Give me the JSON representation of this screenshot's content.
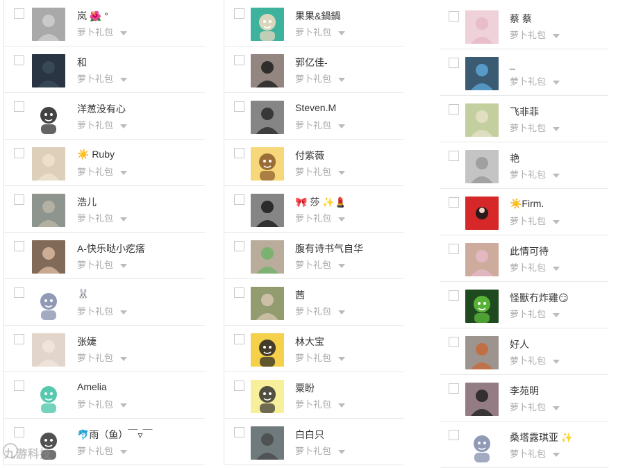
{
  "tag_label": "萝卜礼包",
  "watermark_text": "九游科技",
  "columns": [
    {
      "items": [
        {
          "name": "岚 🌺 °",
          "avatar": "avatar-photo",
          "colors": [
            "#8a8a8a",
            "#cfcfcf"
          ]
        },
        {
          "name": "和",
          "avatar": "avatar-photo",
          "colors": [
            "#1a2430",
            "#3b4b5a"
          ]
        },
        {
          "name": "洋葱没有心",
          "avatar": "avatar-cartoon",
          "colors": [
            "#ffffff",
            "#222222"
          ]
        },
        {
          "name": "☀️ Ruby",
          "avatar": "avatar-photo",
          "colors": [
            "#cfc0a6",
            "#eee3d0"
          ]
        },
        {
          "name": "浩儿",
          "avatar": "avatar-photo",
          "colors": [
            "#6b7b78",
            "#b8b6a8"
          ]
        },
        {
          "name": "A-快乐哒小疙瘩",
          "avatar": "avatar-photo",
          "colors": [
            "#3a2a1e",
            "#d9b9a0"
          ]
        },
        {
          "name": "🐰",
          "avatar": "avatar-cartoon",
          "colors": [
            "#ffffff",
            "#7c87a8"
          ]
        },
        {
          "name": "张婕",
          "avatar": "avatar-photo",
          "colors": [
            "#d8c7ba",
            "#f0e6df"
          ]
        },
        {
          "name": "Amelia",
          "avatar": "avatar-cartoon",
          "colors": [
            "#ffffff",
            "#39c0a0"
          ]
        },
        {
          "name": "🐬雨（鱼）￣▿￣",
          "avatar": "avatar-cartoon",
          "colors": [
            "#ffffff",
            "#333333"
          ]
        }
      ]
    },
    {
      "items": [
        {
          "name": "果果&鍋鍋",
          "avatar": "avatar-cartoon",
          "colors": [
            "#3db39e",
            "#f6dcc2"
          ]
        },
        {
          "name": "郭亿佳-",
          "avatar": "avatar-photo",
          "colors": [
            "#f3d9d0",
            "#1f1f1f"
          ]
        },
        {
          "name": "Steven.M",
          "avatar": "avatar-photo",
          "colors": [
            "#d0d0d0",
            "#2a2a2a"
          ]
        },
        {
          "name": "付紫薇",
          "avatar": "avatar-cartoon",
          "colors": [
            "#f6d87a",
            "#8b5a2b"
          ]
        },
        {
          "name": "🎀 莎 ✨💄",
          "avatar": "avatar-photo",
          "colors": [
            "#dcdcdc",
            "#1b1b1b"
          ]
        },
        {
          "name": "腹有诗书气自华",
          "avatar": "avatar-photo",
          "colors": [
            "#f6a7c3",
            "#70b36b"
          ]
        },
        {
          "name": "茜",
          "avatar": "avatar-photo",
          "colors": [
            "#5c7a3a",
            "#d6c6b0"
          ]
        },
        {
          "name": "林大宝",
          "avatar": "avatar-cartoon",
          "colors": [
            "#f5d04a",
            "#222222"
          ]
        },
        {
          "name": "粟盼",
          "avatar": "avatar-cartoon",
          "colors": [
            "#f8ef9a",
            "#333333"
          ]
        },
        {
          "name": "白白只",
          "avatar": "avatar-photo",
          "colors": [
            "#8fa3a8",
            "#4a4a4a"
          ]
        }
      ]
    },
    {
      "items": [
        {
          "name": "蔡 蔡",
          "avatar": "avatar-photo",
          "colors": [
            "#f4e5ea",
            "#e7b9c6"
          ]
        },
        {
          "name": "_",
          "avatar": "avatar-photo",
          "colors": [
            "#1f1f1f",
            "#5da4d6"
          ]
        },
        {
          "name": "飞非菲",
          "avatar": "avatar-photo",
          "colors": [
            "#a7c27d",
            "#e6e0c8"
          ]
        },
        {
          "name": "艳",
          "avatar": "avatar-photo",
          "colors": [
            "#e7e7e7",
            "#9a9a9a"
          ]
        },
        {
          "name": "☀️Firm.",
          "avatar": "avatar-logo",
          "colors": [
            "#d62828",
            "#2a1a1a"
          ]
        },
        {
          "name": "此情可待",
          "avatar": "avatar-photo",
          "colors": [
            "#b9a27a",
            "#e7b9c8"
          ]
        },
        {
          "name": "怪獸冇炸雞😏",
          "avatar": "avatar-cartoon",
          "colors": [
            "#1f4a1f",
            "#64c43d"
          ]
        },
        {
          "name": "好人",
          "avatar": "avatar-photo",
          "colors": [
            "#7db6d6",
            "#c76a3a"
          ]
        },
        {
          "name": "李苑明",
          "avatar": "avatar-photo",
          "colors": [
            "#f2c7d6",
            "#222222"
          ]
        },
        {
          "name": "桑塔露琪亚 ✨",
          "avatar": "avatar-cartoon",
          "colors": [
            "#ffffff",
            "#7c87a8"
          ]
        }
      ]
    }
  ]
}
